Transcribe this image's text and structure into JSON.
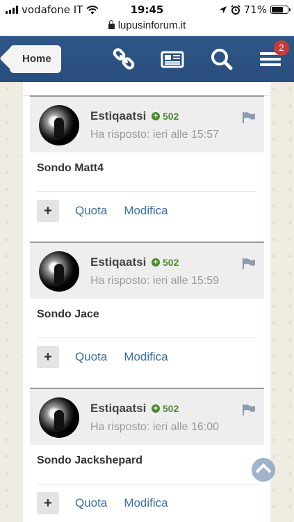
{
  "status_bar": {
    "carrier": "vodafone IT",
    "time": "19:45",
    "battery": "71%",
    "battery_level": 0.71
  },
  "address_bar": {
    "url": "lupusinforum.it"
  },
  "navbar": {
    "home_label": "Home",
    "icons": [
      "link-icon",
      "newspaper-icon",
      "search-icon",
      "menu-icon"
    ],
    "notification_count": "2"
  },
  "posts": [
    {
      "author": "Estiqaatsi",
      "reputation": "502",
      "timestamp": "Ha risposto: ieri alle 15:57",
      "body": "Sondo Matt4",
      "actions": {
        "plus": "+",
        "quote": "Quota",
        "edit": "Modifica"
      }
    },
    {
      "author": "Estiqaatsi",
      "reputation": "502",
      "timestamp": "Ha risposto: ieri alle 15:59",
      "body": "Sondo Jace",
      "actions": {
        "plus": "+",
        "quote": "Quota",
        "edit": "Modifica"
      }
    },
    {
      "author": "Estiqaatsi",
      "reputation": "502",
      "timestamp": "Ha risposto: ieri alle 16:00",
      "body": "Sondo Jackshepard",
      "actions": {
        "plus": "+",
        "quote": "Quota",
        "edit": "Modifica"
      }
    }
  ],
  "colors": {
    "navbar": "#2c5282",
    "reputation": "#4b8a2d",
    "link": "#3a6ea5",
    "badge": "#c93a3a"
  }
}
